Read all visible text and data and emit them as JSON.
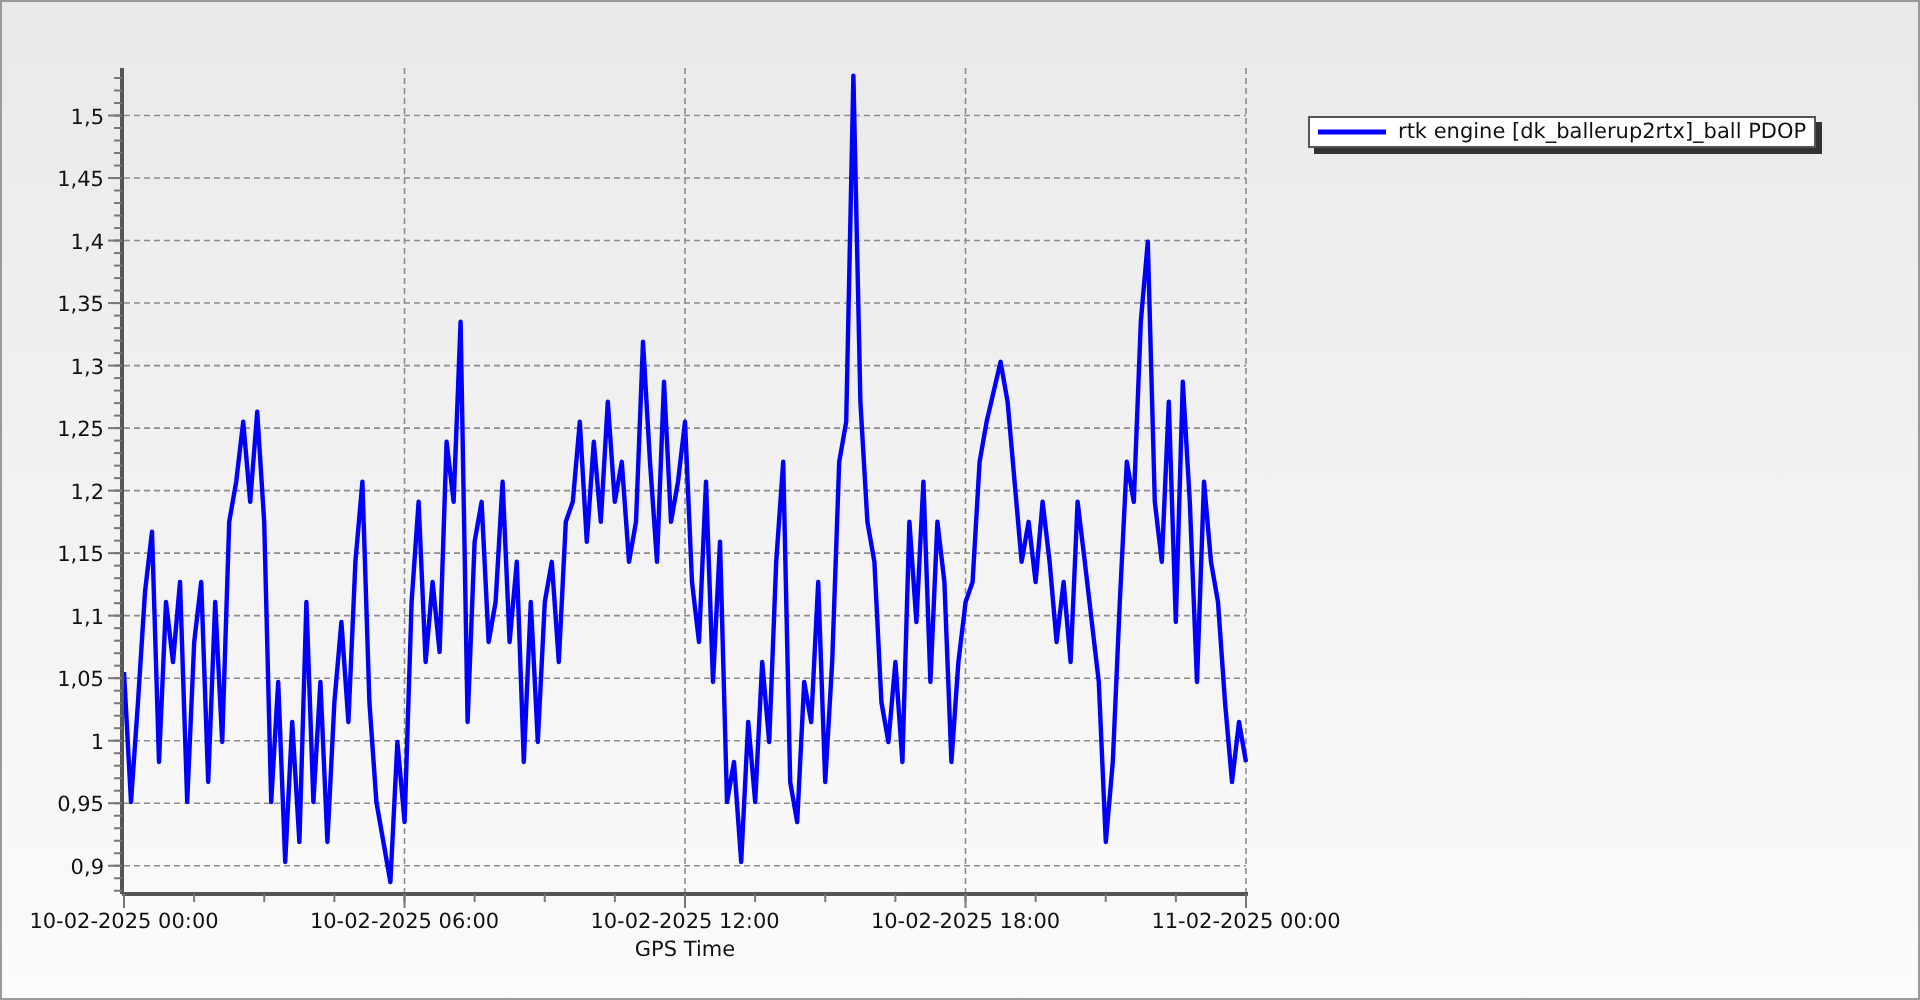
{
  "chart": {
    "chart_data": {
      "type": "line",
      "xlabel": "GPS Time",
      "grid": true,
      "ylim": [
        0.879,
        1.538
      ],
      "categories": [
        "10-02-2025 00:00",
        null,
        null,
        null,
        null,
        null,
        null,
        null,
        null,
        null,
        null,
        null,
        null,
        null,
        null,
        null,
        null,
        null,
        null,
        null,
        null,
        null,
        null,
        null,
        null,
        null,
        null,
        null,
        null,
        null,
        null,
        null,
        null,
        null,
        null,
        null,
        null,
        null,
        null,
        null,
        "10-02-2025 06:00",
        null,
        null,
        null,
        null,
        null,
        null,
        null,
        null,
        null,
        null,
        null,
        null,
        null,
        null,
        null,
        null,
        null,
        null,
        null,
        null,
        null,
        null,
        null,
        null,
        null,
        null,
        null,
        null,
        null,
        null,
        null,
        null,
        null,
        null,
        null,
        null,
        null,
        null,
        null,
        "10-02-2025 12:00",
        null,
        null,
        null,
        null,
        null,
        null,
        null,
        null,
        null,
        null,
        null,
        null,
        null,
        null,
        null,
        null,
        null,
        null,
        null,
        null,
        null,
        null,
        null,
        null,
        null,
        null,
        null,
        null,
        null,
        null,
        null,
        null,
        null,
        null,
        null,
        null,
        null,
        null,
        null,
        "10-02-2025 18:00",
        null,
        null,
        null,
        null,
        null,
        null,
        null,
        null,
        null,
        null,
        null,
        null,
        null,
        null,
        null,
        null,
        null,
        null,
        null,
        null,
        null,
        null,
        null,
        null,
        null,
        null,
        null,
        null,
        null,
        null,
        null,
        null,
        null,
        null,
        null,
        null,
        null,
        null,
        null,
        "11-02-2025 00:00"
      ],
      "yticks": [
        {
          "value": 1.5,
          "label": "1,5"
        },
        {
          "value": 1.45,
          "label": "1,45"
        },
        {
          "value": 1.4,
          "label": "1,4"
        },
        {
          "value": 1.35,
          "label": "1,35"
        },
        {
          "value": 1.3,
          "label": "1,3"
        },
        {
          "value": 1.25,
          "label": "1,25"
        },
        {
          "value": 1.2,
          "label": "1,2"
        },
        {
          "value": 1.15,
          "label": "1,15"
        },
        {
          "value": 1.1,
          "label": "1,1"
        },
        {
          "value": 1.05,
          "label": "1,05"
        },
        {
          "value": 1,
          "label": "1"
        },
        {
          "value": 0.95,
          "label": "0,95"
        },
        {
          "value": 0.9,
          "label": "0,9"
        }
      ],
      "series": [
        {
          "name": "rtk engine [dk_ballerup2rtx]_ball PDOP",
          "color": "#0000ff",
          "values": [
            1.055,
            0.951,
            1.031,
            1.119,
            1.167,
            0.983,
            1.111,
            1.063,
            1.127,
            0.951,
            1.079,
            1.127,
            0.967,
            1.111,
            0.999,
            1.175,
            1.207,
            1.255,
            1.191,
            1.263,
            1.175,
            0.951,
            1.047,
            0.903,
            1.015,
            0.919,
            1.111,
            0.951,
            1.047,
            0.919,
            1.031,
            1.095,
            1.015,
            1.143,
            1.207,
            1.031,
            0.951,
            0.919,
            0.887,
            0.999,
            0.935,
            1.111,
            1.191,
            1.063,
            1.127,
            1.071,
            1.239,
            1.191,
            1.335,
            1.015,
            1.159,
            1.191,
            1.079,
            1.111,
            1.207,
            1.079,
            1.143,
            0.983,
            1.111,
            0.999,
            1.111,
            1.143,
            1.063,
            1.175,
            1.191,
            1.255,
            1.159,
            1.239,
            1.175,
            1.271,
            1.191,
            1.223,
            1.143,
            1.175,
            1.319,
            1.223,
            1.143,
            1.287,
            1.175,
            1.207,
            1.255,
            1.127,
            1.079,
            1.207,
            1.047,
            1.159,
            0.951,
            0.983,
            0.903,
            1.015,
            0.951,
            1.063,
            0.999,
            1.143,
            1.223,
            0.967,
            0.935,
            1.047,
            1.015,
            1.127,
            0.967,
            1.063,
            1.223,
            1.255,
            1.532,
            1.271,
            1.175,
            1.143,
            1.031,
            0.999,
            1.063,
            0.983,
            1.175,
            1.095,
            1.207,
            1.047,
            1.175,
            1.127,
            0.983,
            1.063,
            1.111,
            1.127,
            1.223,
            1.255,
            1.279,
            1.303,
            1.271,
            1.207,
            1.143,
            1.175,
            1.127,
            1.191,
            1.143,
            1.079,
            1.127,
            1.063,
            1.191,
            1.143,
            1.095,
            1.047,
            0.919,
            0.983,
            1.111,
            1.223,
            1.191,
            1.335,
            1.399,
            1.191,
            1.143,
            1.271,
            1.095,
            1.287,
            1.191,
            1.047,
            1.207,
            1.143,
            1.111,
            1.031,
            0.967,
            1.015,
            0.983
          ]
        }
      ]
    }
  }
}
